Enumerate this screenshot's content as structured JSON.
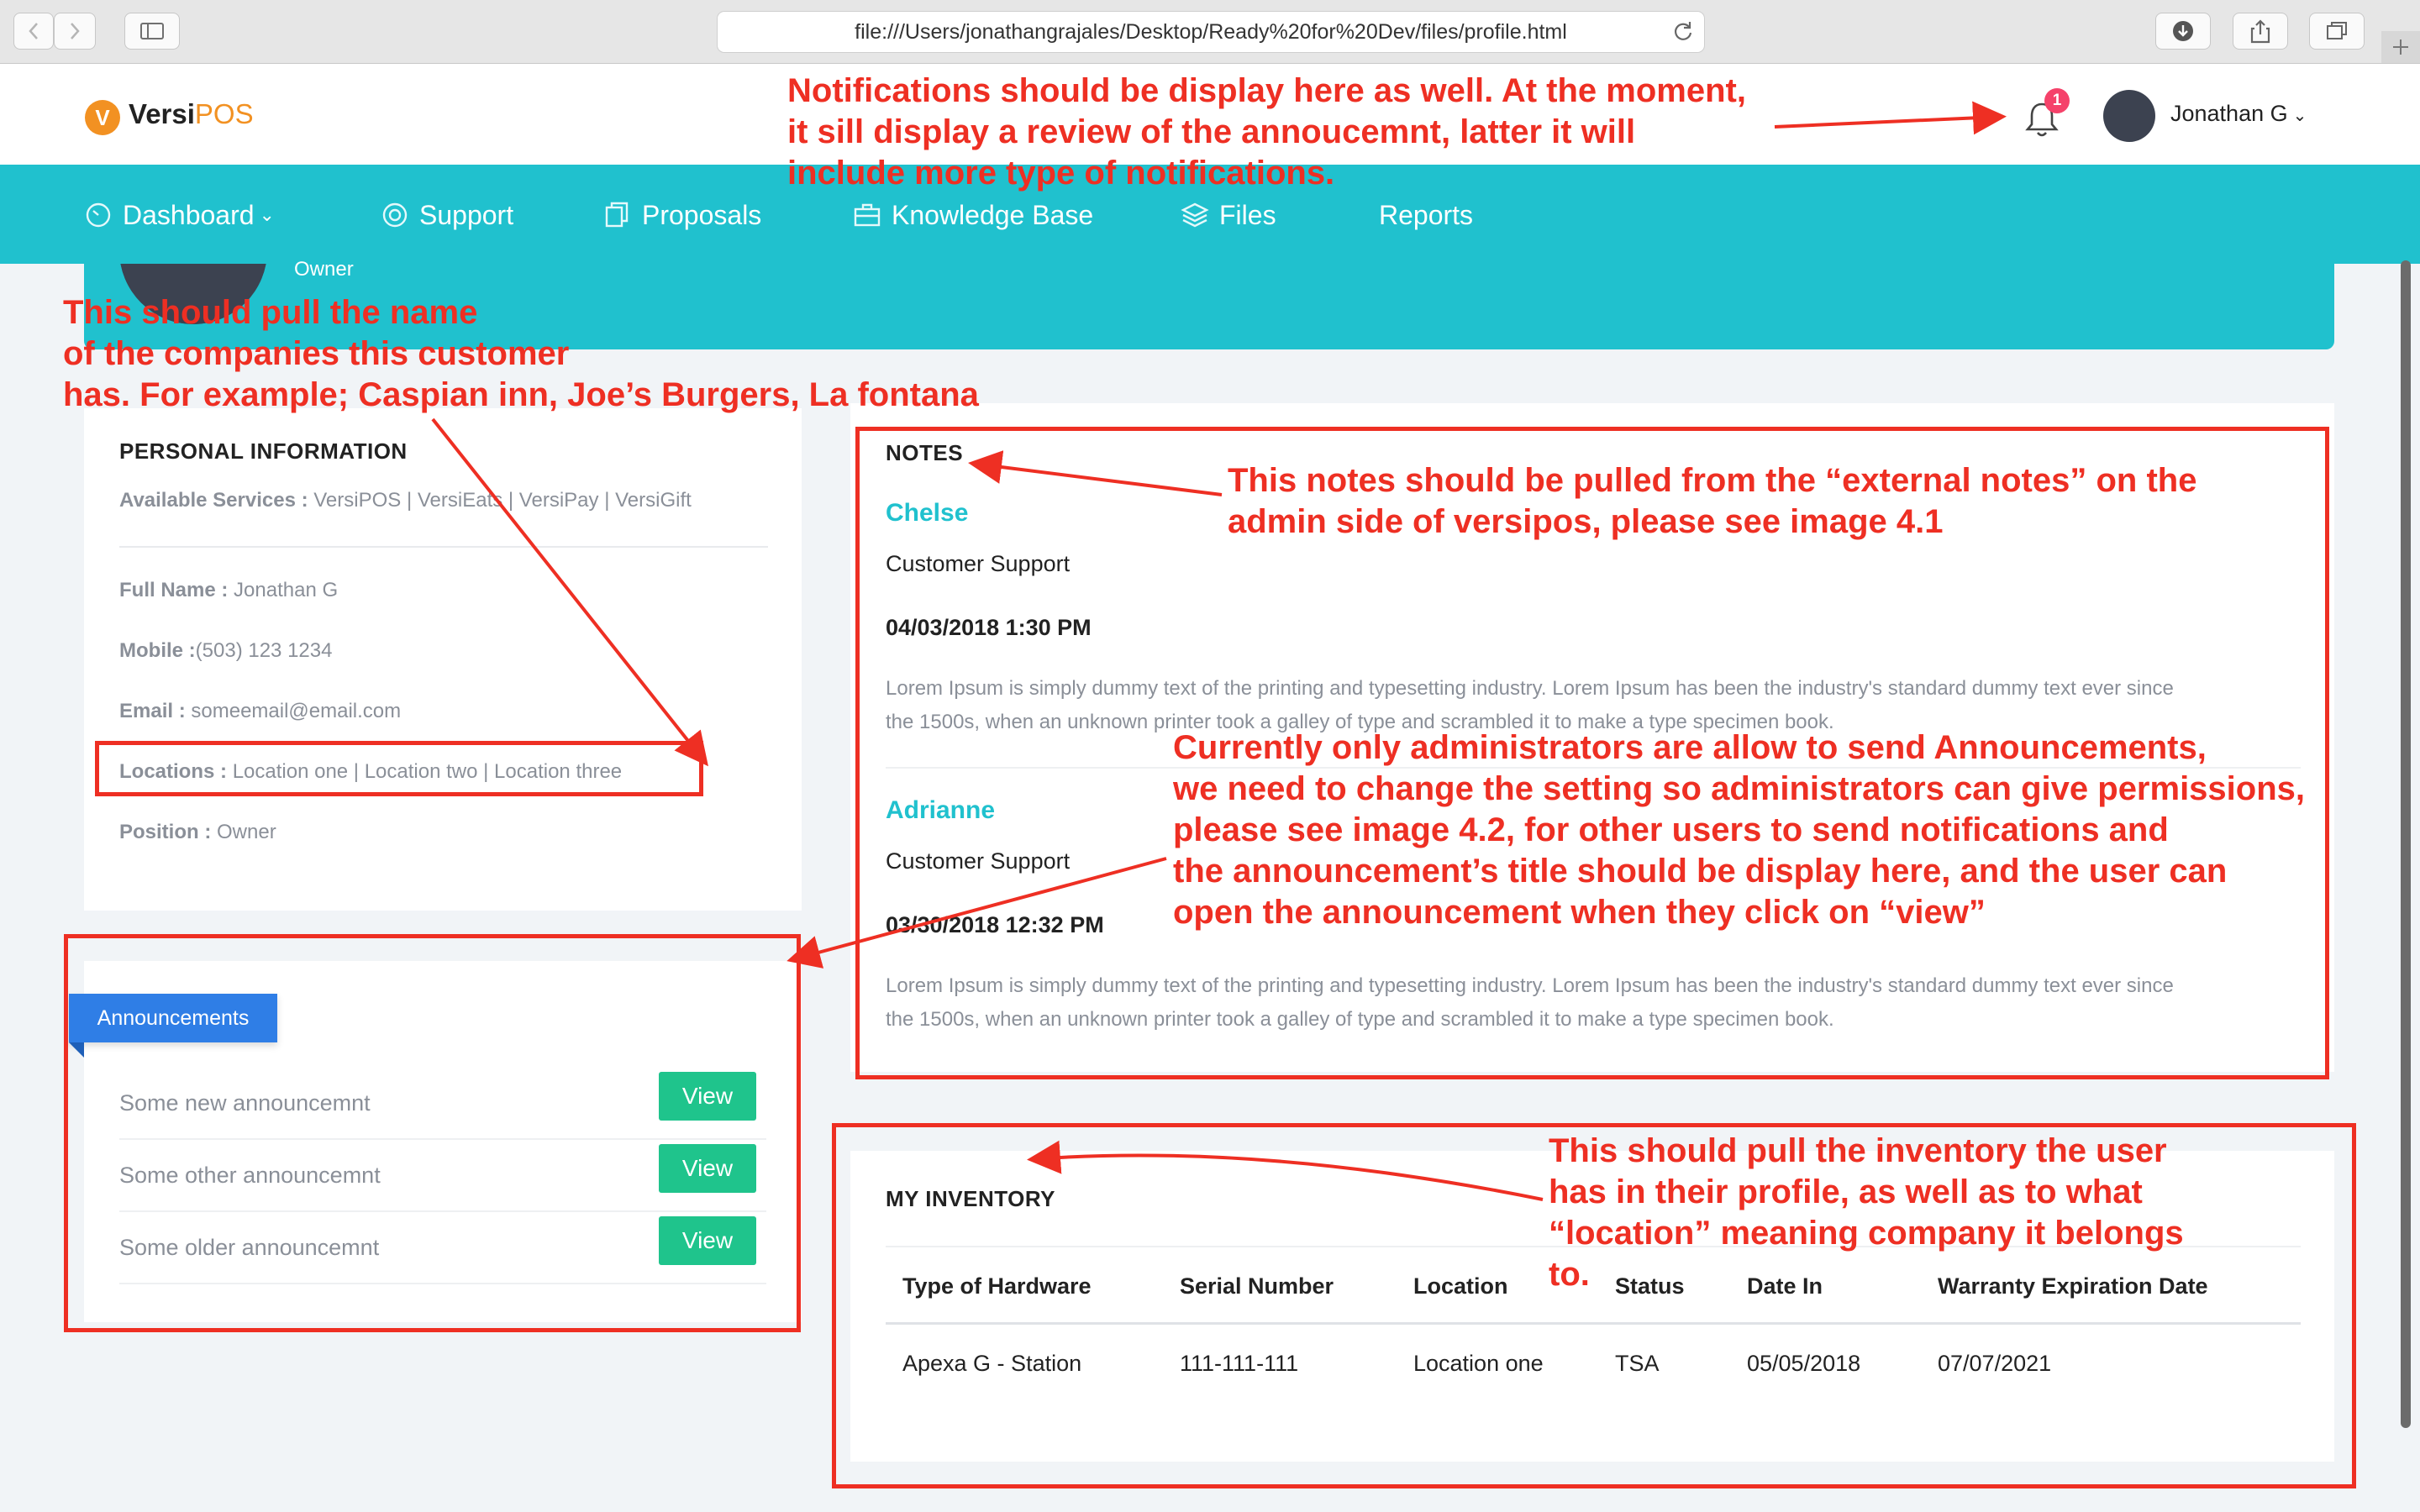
{
  "browser": {
    "url": "file:///Users/jonathangrajales/Desktop/Ready%20for%20Dev/files/profile.html"
  },
  "header": {
    "logo_letter": "V",
    "logo_text_dark": "Versi",
    "logo_text_accent": "POS",
    "notification_count": "1",
    "user_name": "Jonathan G"
  },
  "nav": {
    "items": [
      {
        "label": "Dashboard",
        "icon": "gauge-icon"
      },
      {
        "label": "Support",
        "icon": "lifebuoy-icon"
      },
      {
        "label": "Proposals",
        "icon": "documents-icon"
      },
      {
        "label": "Knowledge Base",
        "icon": "briefcase-icon"
      },
      {
        "label": "Files",
        "icon": "layers-icon"
      },
      {
        "label": "Reports",
        "icon": ""
      }
    ]
  },
  "profile": {
    "role": "Owner"
  },
  "personal_info": {
    "title": "PERSONAL INFORMATION",
    "services_label": "Available Services :",
    "services_value": "VersiPOS | VersiEats | VersiPay | VersiGift",
    "full_name_label": "Full Name :",
    "full_name_value": "Jonathan G",
    "mobile_label": "Mobile :",
    "mobile_value": "(503) 123 1234",
    "email_label": "Email :",
    "email_value": "someemail@email.com",
    "locations_label": "Locations :",
    "locations_value": "Location one | Location two | Location three",
    "position_label": "Position :",
    "position_value": "Owner"
  },
  "announcements": {
    "tag": "Announcements",
    "button_label": "View",
    "items": [
      "Some new announcemnt",
      "Some other announcemnt",
      "Some older announcemnt"
    ]
  },
  "notes": {
    "title": "NOTES",
    "entries": [
      {
        "name": "Chelse",
        "role": "Customer Support",
        "date": "04/03/2018 1:30 PM",
        "body_line1": "Lorem Ipsum is simply dummy text of the printing and typesetting industry. Lorem Ipsum has been the industry's standard dummy text ever since",
        "body_line2": "the 1500s, when an unknown printer took a galley of type and scrambled it to make a type specimen book."
      },
      {
        "name": "Adrianne",
        "role": "Customer Support",
        "date": "03/30/2018 12:32 PM",
        "body_line1": "Lorem Ipsum is simply dummy text of the printing and typesetting industry. Lorem Ipsum has been the industry's standard dummy text ever since",
        "body_line2": "the 1500s, when an unknown printer took a galley of type and scrambled it to make a type specimen book."
      }
    ]
  },
  "inventory": {
    "title": "MY INVENTORY",
    "headers": [
      "Type of Hardware",
      "Serial Number",
      "Location",
      "Status",
      "Date In",
      "Warranty Expiration Date"
    ],
    "rows": [
      [
        "Apexa G - Station",
        "111-111-111",
        "Location one",
        "TSA",
        "05/05/2018",
        "07/07/2021"
      ]
    ]
  },
  "annotations": {
    "notifications": [
      "Notifications should be display here as well. At the moment,",
      "it sill display a review of the annoucemnt, latter it will",
      "include more type of notifications."
    ],
    "companies": [
      "This should pull the name",
      "of the companies this customer",
      "has. For example; Caspian inn, Joe’s Burgers, La fontana"
    ],
    "notes": [
      "This notes should be pulled from the “external notes” on the",
      "admin side of versipos, please see image 4.1"
    ],
    "announcements": [
      "Currently only administrators are allow to send Announcements,",
      "we need to change the setting so administrators can give permissions,",
      "please see image 4.2, for other users to send notifications and",
      "the announcement’s title should be display here, and the user can",
      "open the announcement when they click on “view”"
    ],
    "inventory": [
      "This should pull the inventory the user",
      "has in their profile, as well as to what",
      "“location” meaning company it belongs",
      "to."
    ]
  }
}
